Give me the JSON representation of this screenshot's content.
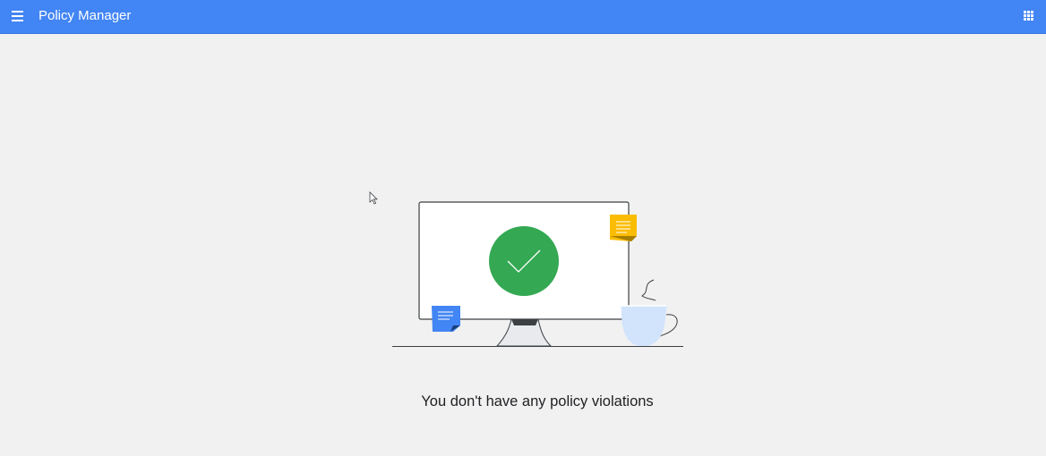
{
  "header": {
    "title": "Policy Manager",
    "menu_icon": "hamburger-menu-icon",
    "apps_icon": "apps-grid-icon"
  },
  "empty_state": {
    "message": "You don't have any policy violations",
    "illustration": "computer-monitor-with-checkmark-illustration"
  },
  "colors": {
    "header": "#4285f4",
    "background": "#f1f1f1",
    "check_circle": "#34a853",
    "sticky_note_yellow": "#fbbc04",
    "sticky_note_blue": "#4285f4",
    "mug": "#d2e3fc"
  }
}
